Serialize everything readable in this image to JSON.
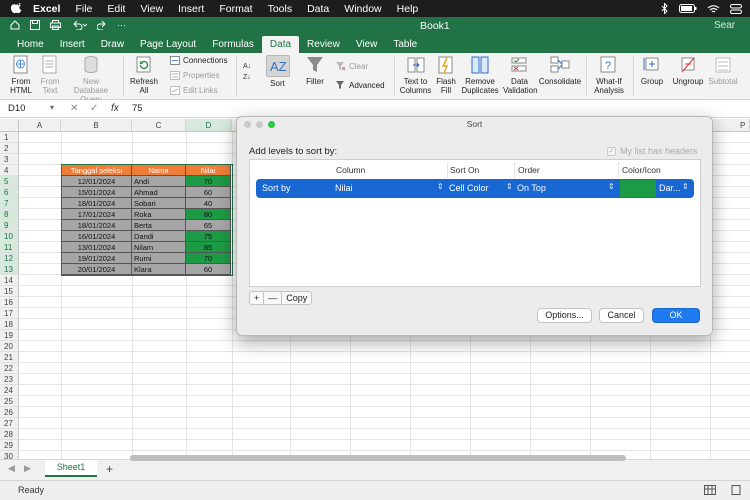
{
  "menubar": {
    "app": "Excel",
    "items": [
      "File",
      "Edit",
      "View",
      "Insert",
      "Format",
      "Tools",
      "Data",
      "Window",
      "Help"
    ]
  },
  "titlebar": {
    "title": "Book1",
    "search_placeholder": "Sear"
  },
  "ribbon_tabs": {
    "items": [
      "Home",
      "Insert",
      "Draw",
      "Page Layout",
      "Formulas",
      "Data",
      "Review",
      "View",
      "Table"
    ],
    "active": "Data"
  },
  "ribbon": {
    "from_html": "From HTML",
    "from_text": "From Text",
    "new_db_query": "New Database Query",
    "refresh_all": "Refresh All",
    "connections": "Connections",
    "properties": "Properties",
    "edit_links": "Edit Links",
    "sort": "Sort",
    "filter": "Filter",
    "clear": "Clear",
    "advanced": "Advanced",
    "text_to_columns": "Text to Columns",
    "flash_fill": "Flash Fill",
    "remove_duplicates": "Remove Duplicates",
    "data_validation": "Data Validation",
    "consolidate": "Consolidate",
    "what_if": "What-If Analysis",
    "group": "Group",
    "ungroup": "Ungroup",
    "subtotal": "Subtotal"
  },
  "formula_bar": {
    "cell_ref": "D10",
    "fx": "fx",
    "value": "75"
  },
  "grid": {
    "columns": [
      "A",
      "B",
      "C",
      "D",
      "P"
    ],
    "rows": [
      "1",
      "2",
      "3",
      "4",
      "5",
      "6",
      "7",
      "8",
      "9",
      "10",
      "11",
      "12",
      "13",
      "14",
      "15",
      "16",
      "17",
      "18",
      "19",
      "20",
      "21",
      "22",
      "23",
      "24",
      "25",
      "26",
      "27",
      "28",
      "29",
      "30"
    ]
  },
  "table": {
    "headers": [
      "Tanggal seleksi",
      "Nama",
      "Nilai"
    ],
    "rows": [
      {
        "date": "12/01/2024",
        "name": "Andi",
        "score": "70",
        "highlight": true
      },
      {
        "date": "15/01/2024",
        "name": "Ahmad",
        "score": "60",
        "highlight": false
      },
      {
        "date": "18/01/2024",
        "name": "Sobari",
        "score": "40",
        "highlight": false
      },
      {
        "date": "17/01/2024",
        "name": "Roka",
        "score": "80",
        "highlight": true
      },
      {
        "date": "18/01/2024",
        "name": "Berta",
        "score": "65",
        "highlight": false
      },
      {
        "date": "16/01/2024",
        "name": "Dandi",
        "score": "75",
        "highlight": true
      },
      {
        "date": "13/01/2024",
        "name": "Nilam",
        "score": "85",
        "highlight": true
      },
      {
        "date": "19/01/2024",
        "name": "Rumi",
        "score": "70",
        "highlight": true
      },
      {
        "date": "20/01/2024",
        "name": "Klara",
        "score": "60",
        "highlight": false
      }
    ],
    "colors": {
      "header": "#ee7d38",
      "body": "#a6a6a6",
      "highlight": "#1c9a45"
    }
  },
  "sort_dialog": {
    "title": "Sort",
    "add_levels_label": "Add levels to sort by:",
    "headers_checkbox": "My list has headers",
    "headers_checked": true,
    "col_headers": [
      "Column",
      "Sort On",
      "Order",
      "Color/Icon"
    ],
    "level": {
      "label": "Sort by",
      "column": "Nilai",
      "sort_on": "Cell Color",
      "order": "On Top",
      "color": "#1c9a45",
      "color_name": "Dar..."
    },
    "add_button": "+",
    "remove_button": "—",
    "copy_button": "Copy",
    "options_button": "Options...",
    "cancel_button": "Cancel",
    "ok_button": "OK"
  },
  "sheets": {
    "active": "Sheet1",
    "add": "+"
  },
  "status": {
    "text": "Ready"
  }
}
